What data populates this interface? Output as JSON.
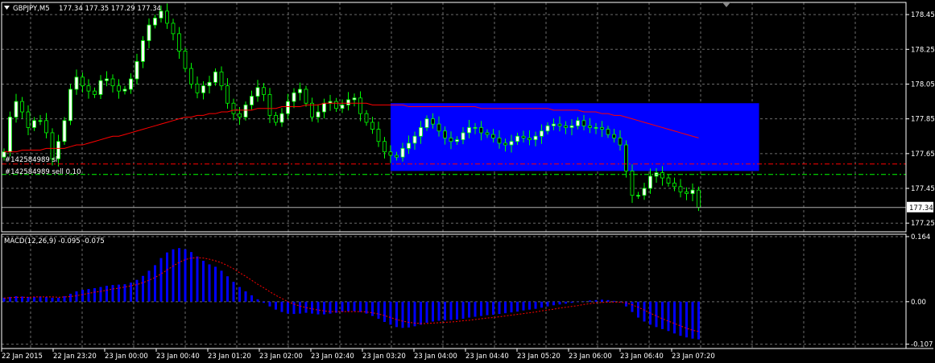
{
  "window": {
    "symbol_label": "GBPJPY,M5",
    "ohlc_label": "177.34 177.35 177.29 177.34",
    "current_price_label": "177.34"
  },
  "orders": {
    "sl_label": "#142584989 sl",
    "sell_label": "#142584989 sell 0.10",
    "sl_price": 177.59,
    "entry_price": 177.53,
    "line_color": "#ff0000"
  },
  "price_axis": {
    "min": 177.2,
    "max": 178.52,
    "labels": [
      "178.45",
      "178.25",
      "178.05",
      "177.85",
      "177.65",
      "177.45",
      "177.25"
    ],
    "values": [
      178.45,
      178.25,
      178.05,
      177.85,
      177.65,
      177.45,
      177.25
    ]
  },
  "macd": {
    "label": "MACD(12,26,9) -0.095 -0.075",
    "axis_labels": [
      "0.164",
      "0.00",
      "-0.107"
    ],
    "axis_values": [
      0.164,
      0.0,
      -0.107
    ],
    "min": -0.118,
    "max": 0.17,
    "hist_color": "#0000ff",
    "signal_color": "#ff0000"
  },
  "time_axis": {
    "labels": [
      "22 Jan 2015",
      "22 Jan 23:20",
      "23 Jan 00:00",
      "23 Jan 00:40",
      "23 Jan 01:20",
      "23 Jan 02:00",
      "23 Jan 02:40",
      "23 Jan 03:20",
      "23 Jan 04:00",
      "23 Jan 04:40",
      "23 Jan 05:20",
      "23 Jan 06:00",
      "23 Jan 06:40",
      "23 Jan 07:20"
    ]
  },
  "colors": {
    "bull_candle": "#ffffff",
    "bear_candle": "#000000",
    "wick": "#00ff00",
    "ma_line": "#ff0000",
    "zone_fill": "#0000ff",
    "grid": "#6b6b6b",
    "axis": "#ffffff"
  },
  "zone": {
    "bar_start": 64,
    "bar_end": 125,
    "price_top": 177.94,
    "price_bottom": 177.55
  },
  "chart_data": {
    "type": "candlestick",
    "closes": [
      177.66,
      177.86,
      177.95,
      177.89,
      177.8,
      177.84,
      177.84,
      177.77,
      177.62,
      177.72,
      177.84,
      178.02,
      178.09,
      178.04,
      178.01,
      177.99,
      178.07,
      178.08,
      178.04,
      178.01,
      178.02,
      178.08,
      178.18,
      178.3,
      178.39,
      178.43,
      178.47,
      178.4,
      178.34,
      178.24,
      178.14,
      178.05,
      178.0,
      178.04,
      178.06,
      178.12,
      178.04,
      177.94,
      177.88,
      177.86,
      177.93,
      177.98,
      178.03,
      177.99,
      177.87,
      177.83,
      177.88,
      177.95,
      178.0,
      178.02,
      177.94,
      177.86,
      177.89,
      177.94,
      177.95,
      177.91,
      177.93,
      177.96,
      177.97,
      177.88,
      177.83,
      177.79,
      177.72,
      177.66,
      177.64,
      177.63,
      177.68,
      177.71,
      177.75,
      177.8,
      177.85,
      177.82,
      177.78,
      177.74,
      177.72,
      177.73,
      177.77,
      177.8,
      177.8,
      177.77,
      177.76,
      177.74,
      177.71,
      177.7,
      177.72,
      177.75,
      177.74,
      177.73,
      177.75,
      177.78,
      177.81,
      177.82,
      177.81,
      177.8,
      177.81,
      177.84,
      177.81,
      177.8,
      177.8,
      177.79,
      177.76,
      177.74,
      177.7,
      177.55,
      177.41,
      177.41,
      177.45,
      177.52,
      177.54,
      177.51,
      177.48,
      177.46,
      177.43,
      177.42,
      177.44,
      177.34
    ],
    "ma_values": [
      177.66,
      177.66,
      177.66,
      177.67,
      177.67,
      177.67,
      177.67,
      177.68,
      177.68,
      177.68,
      177.68,
      177.69,
      177.7,
      177.7,
      177.71,
      177.72,
      177.73,
      177.74,
      177.75,
      177.75,
      177.76,
      177.77,
      177.78,
      177.79,
      177.8,
      177.81,
      177.82,
      177.83,
      177.84,
      177.85,
      177.86,
      177.86,
      177.87,
      177.87,
      177.88,
      177.88,
      177.89,
      177.89,
      177.9,
      177.9,
      177.9,
      177.9,
      177.91,
      177.91,
      177.91,
      177.91,
      177.92,
      177.92,
      177.92,
      177.92,
      177.93,
      177.93,
      177.93,
      177.94,
      177.94,
      177.94,
      177.94,
      177.94,
      177.94,
      177.94,
      177.94,
      177.93,
      177.93,
      177.93,
      177.93,
      177.93,
      177.93,
      177.92,
      177.92,
      177.92,
      177.92,
      177.92,
      177.92,
      177.92,
      177.92,
      177.92,
      177.92,
      177.92,
      177.92,
      177.91,
      177.91,
      177.91,
      177.91,
      177.91,
      177.91,
      177.91,
      177.91,
      177.91,
      177.91,
      177.91,
      177.91,
      177.9,
      177.9,
      177.9,
      177.9,
      177.9,
      177.89,
      177.89,
      177.89,
      177.88,
      177.88,
      177.87,
      177.87,
      177.86,
      177.85,
      177.84,
      177.83,
      177.82,
      177.81,
      177.8,
      177.79,
      177.78,
      177.77,
      177.76,
      177.75,
      177.74
    ],
    "macd_hist": [
      0.01,
      0.012,
      0.014,
      0.013,
      0.012,
      0.012,
      0.013,
      0.012,
      0.01,
      0.01,
      0.014,
      0.02,
      0.026,
      0.03,
      0.032,
      0.034,
      0.037,
      0.04,
      0.042,
      0.043,
      0.044,
      0.048,
      0.055,
      0.065,
      0.078,
      0.092,
      0.11,
      0.124,
      0.132,
      0.135,
      0.132,
      0.125,
      0.114,
      0.103,
      0.094,
      0.088,
      0.078,
      0.064,
      0.05,
      0.037,
      0.026,
      0.016,
      0.006,
      -0.003,
      -0.012,
      -0.02,
      -0.026,
      -0.03,
      -0.031,
      -0.03,
      -0.028,
      -0.03,
      -0.032,
      -0.032,
      -0.03,
      -0.028,
      -0.026,
      -0.024,
      -0.024,
      -0.026,
      -0.03,
      -0.036,
      -0.043,
      -0.051,
      -0.058,
      -0.064,
      -0.066,
      -0.065,
      -0.062,
      -0.058,
      -0.053,
      -0.05,
      -0.048,
      -0.047,
      -0.046,
      -0.045,
      -0.043,
      -0.04,
      -0.038,
      -0.036,
      -0.034,
      -0.033,
      -0.031,
      -0.029,
      -0.027,
      -0.025,
      -0.022,
      -0.02,
      -0.018,
      -0.015,
      -0.012,
      -0.009,
      -0.007,
      -0.005,
      -0.003,
      -0.001,
      0.001,
      0.003,
      0.004,
      0.005,
      0.004,
      0.002,
      -0.002,
      -0.012,
      -0.026,
      -0.04,
      -0.05,
      -0.058,
      -0.064,
      -0.069,
      -0.074,
      -0.08,
      -0.086,
      -0.09,
      -0.093,
      -0.095
    ],
    "macd_signal": [
      0.009,
      0.01,
      0.011,
      0.011,
      0.011,
      0.012,
      0.012,
      0.012,
      0.012,
      0.011,
      0.012,
      0.013,
      0.015,
      0.018,
      0.021,
      0.024,
      0.026,
      0.029,
      0.032,
      0.034,
      0.037,
      0.04,
      0.043,
      0.048,
      0.054,
      0.061,
      0.07,
      0.08,
      0.09,
      0.099,
      0.106,
      0.11,
      0.111,
      0.11,
      0.107,
      0.103,
      0.098,
      0.091,
      0.083,
      0.073,
      0.064,
      0.054,
      0.044,
      0.035,
      0.025,
      0.016,
      0.008,
      0.0,
      -0.006,
      -0.011,
      -0.015,
      -0.018,
      -0.021,
      -0.023,
      -0.025,
      -0.025,
      -0.025,
      -0.025,
      -0.025,
      -0.025,
      -0.026,
      -0.028,
      -0.031,
      -0.035,
      -0.04,
      -0.045,
      -0.049,
      -0.052,
      -0.054,
      -0.055,
      -0.055,
      -0.054,
      -0.053,
      -0.052,
      -0.051,
      -0.05,
      -0.048,
      -0.047,
      -0.045,
      -0.043,
      -0.041,
      -0.04,
      -0.038,
      -0.036,
      -0.034,
      -0.032,
      -0.03,
      -0.028,
      -0.026,
      -0.023,
      -0.021,
      -0.019,
      -0.016,
      -0.014,
      -0.012,
      -0.01,
      -0.007,
      -0.005,
      -0.003,
      -0.002,
      -0.001,
      -0.001,
      -0.001,
      -0.003,
      -0.008,
      -0.014,
      -0.021,
      -0.029,
      -0.036,
      -0.043,
      -0.049,
      -0.055,
      -0.061,
      -0.067,
      -0.072,
      -0.075
    ]
  }
}
